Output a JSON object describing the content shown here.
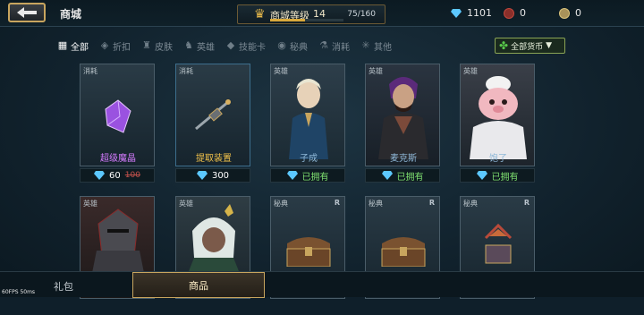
{
  "header": {
    "title": "商城",
    "level_label": "商城等级",
    "level_value": "14",
    "level_progress": "75/160",
    "level_fraction": 0.47
  },
  "currencies": [
    {
      "name": "diamond",
      "value": "1101",
      "color": "#5cc8ff"
    },
    {
      "name": "crimson-coin",
      "value": "0",
      "color": "#c0463c"
    },
    {
      "name": "gold-coin",
      "value": "0",
      "color": "#d9c27a"
    }
  ],
  "filters": [
    {
      "label": "全部",
      "icon": "grid-icon"
    },
    {
      "label": "折扣",
      "icon": "tag-icon"
    },
    {
      "label": "皮肤",
      "icon": "shirt-icon"
    },
    {
      "label": "英雄",
      "icon": "hero-icon"
    },
    {
      "label": "技能卡",
      "icon": "card-icon"
    },
    {
      "label": "秘典",
      "icon": "book-icon"
    },
    {
      "label": "消耗",
      "icon": "potion-icon"
    },
    {
      "label": "其他",
      "icon": "sparkle-icon"
    }
  ],
  "currency_filter": "全部货币",
  "items": [
    {
      "tag": "消耗",
      "name": "超级魔晶",
      "price": "60",
      "old_price": "100",
      "owned": "",
      "name_color": "#d67bff"
    },
    {
      "tag": "消耗",
      "name": "提取装置",
      "price": "300",
      "old_price": "",
      "owned": "",
      "name_color": "#f2c24a"
    },
    {
      "tag": "英雄",
      "name": "子成",
      "price": "",
      "old_price": "",
      "owned": "已拥有",
      "name_color": "#8fb8d8"
    },
    {
      "tag": "英雄",
      "name": "麦克斯",
      "price": "",
      "old_price": "",
      "owned": "已拥有",
      "name_color": "#8fb8d8"
    },
    {
      "tag": "英雄",
      "name": "饱了",
      "price": "",
      "old_price": "",
      "owned": "已拥有",
      "name_color": "#8fb8d8"
    },
    {
      "tag": "英雄",
      "name": "",
      "r": ""
    },
    {
      "tag": "英雄",
      "name": "",
      "r": ""
    },
    {
      "tag": "秘典",
      "name": "",
      "r": "R"
    },
    {
      "tag": "秘典",
      "name": "",
      "r": "R"
    },
    {
      "tag": "秘典",
      "name": "",
      "r": "R"
    }
  ],
  "bottom_tabs": [
    "礼包",
    "商品"
  ],
  "fps": "60FPS",
  "ping": "50ms"
}
